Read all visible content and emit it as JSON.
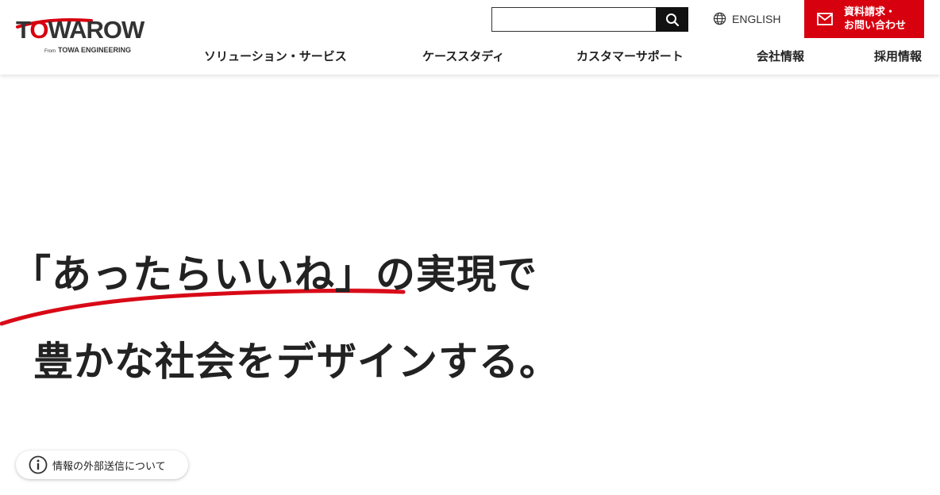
{
  "logo": {
    "brand_prefix": "T",
    "brand_red": "O",
    "brand_rest": "WAROW",
    "sub_small": "From",
    "sub_main": "TOWA ENGINEERING"
  },
  "search": {
    "placeholder": "",
    "value": "",
    "button_icon": "search-icon"
  },
  "language": {
    "icon": "globe-icon",
    "label": "ENGLISH"
  },
  "contact": {
    "icon": "mail-icon",
    "line1": "資料請求・",
    "line2": "お問い合わせ"
  },
  "nav": {
    "items": [
      {
        "label": "ソリューション・サービス"
      },
      {
        "label": "ケーススタディ"
      },
      {
        "label": "カスタマーサポート"
      },
      {
        "label": "会社情報"
      },
      {
        "label": "採用情報"
      }
    ]
  },
  "hero": {
    "line1": "「あったらいいね」の実現で",
    "line2": "豊かな社会をデザインする。"
  },
  "info_pill": {
    "icon": "info-icon",
    "label": "情報の外部送信について"
  },
  "colors": {
    "brand_red": "#d7000f",
    "text": "#222222",
    "search_button": "#111111"
  }
}
